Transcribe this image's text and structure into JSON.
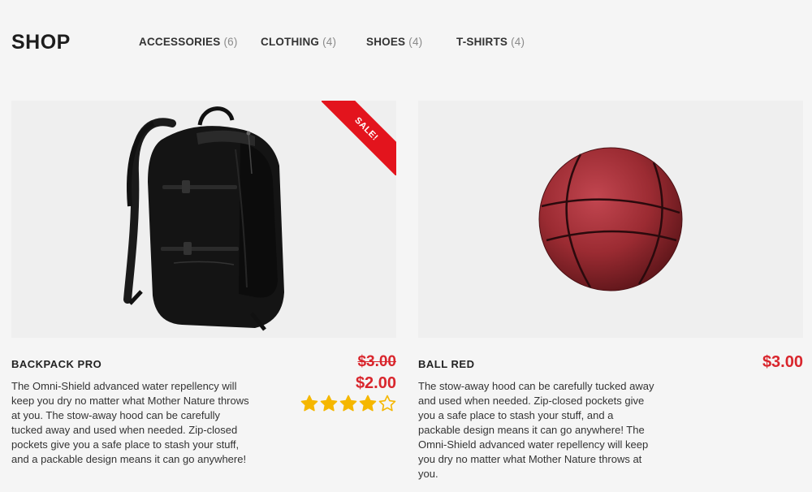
{
  "header": {
    "title": "SHOP"
  },
  "categories": [
    {
      "label": "ACCESSORIES",
      "count": "(6)"
    },
    {
      "label": "CLOTHING",
      "count": "(4)"
    },
    {
      "label": "SHOES",
      "count": "(4)"
    },
    {
      "label": "T-SHIRTS",
      "count": "(4)"
    }
  ],
  "products": [
    {
      "name": "BACKPACK PRO",
      "badge": "SALE!",
      "old_price": "$3.00",
      "price": "$2.00",
      "rating": 4,
      "rating_max": 5,
      "description": "The Omni-Shield advanced water repellency will keep you dry no matter what Mother Nature throws at you. The stow-away hood can be carefully tucked away and used when needed. Zip-closed pockets give you a safe place to stash your stuff, and a packable design means it can go anywhere!",
      "image_icon": "backpack-icon"
    },
    {
      "name": "BALL RED",
      "price": "$3.00",
      "description": "The stow-away hood can be carefully tucked away and used when needed. Zip-closed pockets give you a safe place to stash your stuff, and a packable design means it can go anywhere! The Omni-Shield advanced water repellency will keep you dry no matter what Mother Nature throws at you.",
      "image_icon": "basketball-icon"
    }
  ],
  "colors": {
    "accent_red": "#d9262d",
    "star_gold": "#f5b700",
    "ball_red": "#9b2b32"
  }
}
